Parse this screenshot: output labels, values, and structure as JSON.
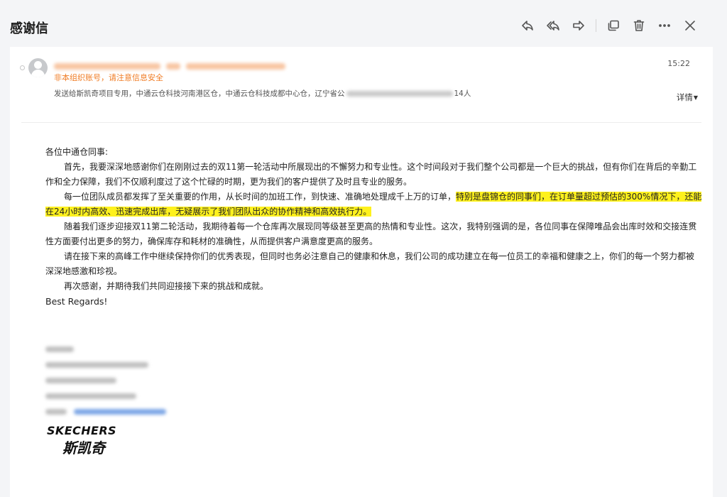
{
  "window": {
    "title": "感谢信"
  },
  "toolbar": [
    {
      "name": "reply-icon"
    },
    {
      "name": "reply-all-icon"
    },
    {
      "name": "forward-icon"
    },
    {
      "name": "open-new-window-icon"
    },
    {
      "name": "delete-icon"
    },
    {
      "name": "more-icon"
    },
    {
      "name": "close-icon"
    }
  ],
  "header": {
    "warning": "非本组织账号，请注意信息安全",
    "recipients_prefix": "发送给斯凯奇项目专用，中通云仓科技河南港区仓，中通云仓科技成都中心仓，辽宁省公",
    "recipients_suffix": "14人",
    "time": "15:22",
    "details_label": "详情"
  },
  "body": {
    "greeting": "各位中通仓同事:",
    "p1": "首先，我要深深地感谢你们在刚刚过去的双11第一轮活动中所展现出的不懈努力和专业性。这个时间段对于我们整个公司都是一个巨大的挑战，但有你们在背后的辛勤工作和全力保障，我们不仅顺利度过了这个忙碌的时期，更为我们的客户提供了及时且专业的服务。",
    "p2_normal": "每一位团队成员都发挥了至关重要的作用，从长时间的加班工作，到快速、准确地处理成千上万的订单，",
    "p2_highlight": "特别是盘锦仓的同事们，在订单量超过预估的300%情况下，还能在24小时内高效、迅速完成出库，无疑展示了我们团队出众的协作精神和高效执行力。",
    "p3": "随着我们逐步迎接双11第二轮活动，我期待着每一个仓库再次展现同等级甚至更高的热情和专业性。这次，我特别强调的是，各位同事在保障唯品会出库时效和交接连贯性方面要付出更多的努力，确保库存和耗材的准确性，从而提供客户满意度更高的服务。",
    "p4": "请在接下来的高峰工作中继续保持你们的优秀表现，但同时也务必注意自己的健康和休息，我们公司的成功建立在每一位员工的幸福和健康之上，你们的每一个努力都被深深地感激和珍视。",
    "p5": "再次感谢，并期待我们共同迎接接下来的挑战和成就。",
    "regards": "Best Regards!"
  },
  "signature": {
    "logo_en": "SKECHERS",
    "logo_cn": "斯凯奇"
  },
  "colors": {
    "highlight": "#fef11d",
    "warning": "#f07c24",
    "background": "#f4f5f7"
  }
}
